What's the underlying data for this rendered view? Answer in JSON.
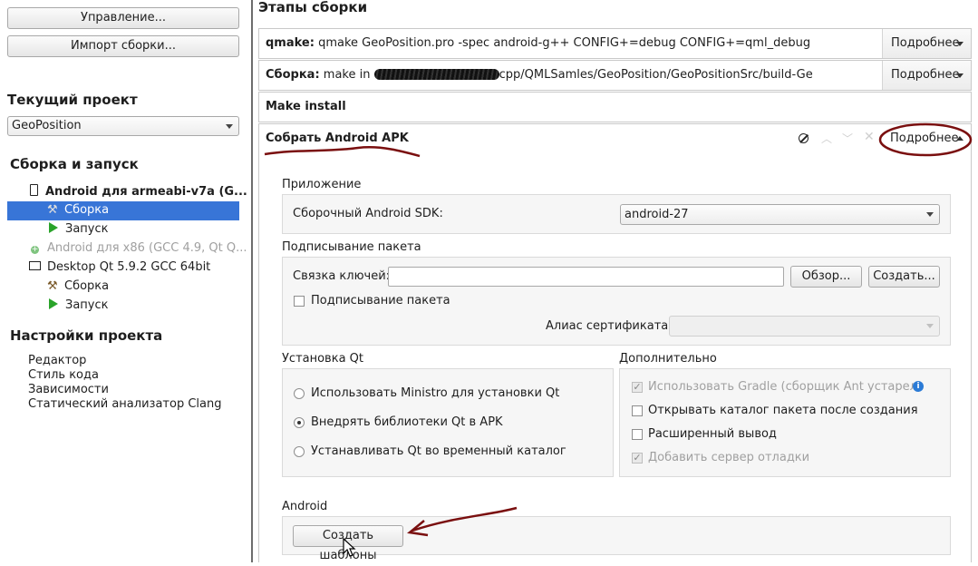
{
  "left": {
    "manage_btn": "Управление...",
    "import_btn": "Импорт сборки...",
    "current_project_title": "Текущий проект",
    "project_select": "GeoPosition",
    "build_run_title": "Сборка и запуск",
    "kits": [
      {
        "label": "Android для armeabi-v7a (G...",
        "build": "Сборка",
        "run": "Запуск"
      },
      {
        "label": "Android для x86 (GCC 4.9, Qt Q..."
      },
      {
        "label": "Desktop Qt 5.9.2 GCC 64bit",
        "build": "Сборка",
        "run": "Запуск"
      }
    ],
    "project_settings_title": "Настройки проекта",
    "settings_links": [
      "Редактор",
      "Стиль кода",
      "Зависимости",
      "Статический анализатор Clang"
    ]
  },
  "main": {
    "title": "Этапы сборки",
    "details_label": "Подробнее",
    "steps": [
      {
        "name": "qmake:",
        "desc": "qmake GeoPosition.pro -spec android-g++ CONFIG+=debug CONFIG+=qml_debug"
      },
      {
        "name": "Сборка:",
        "desc_pre": "make in",
        "desc": "cpp/QMLSamles/GeoPosition/GeoPositionSrc/build-Ge"
      },
      {
        "name": "Make install"
      },
      {
        "name": "Собрать Android APK"
      }
    ],
    "application_group": "Приложение",
    "sdk_label": "Сборочный Android SDK:",
    "sdk_value": "android-27",
    "signing_group": "Подписывание пакета",
    "keystore_label": "Связка ключей:",
    "browse_btn": "Обзор...",
    "create_btn": "Создать...",
    "sign_pkg_check": "Подписывание пакета",
    "cert_alias_label": "Алиас сертификата:",
    "qt_install_group": "Установка Qt",
    "qt_options": [
      "Использовать Ministro для установки Qt",
      "Внедрять библиотеки Qt в APK",
      "Устанавливать Qt во временный каталог"
    ],
    "qt_selected": 1,
    "advanced_group": "Дополнительно",
    "advanced_options": [
      {
        "label": "Использовать Gradle (сборщик Ant устарел)",
        "checked": true,
        "disabled": true
      },
      {
        "label": "Открывать каталог пакета после создания",
        "checked": false,
        "disabled": false
      },
      {
        "label": "Расширенный вывод",
        "checked": false,
        "disabled": false
      },
      {
        "label": "Добавить сервер отладки",
        "checked": true,
        "disabled": true
      }
    ],
    "android_group": "Android",
    "create_templates_btn": "Создать шаблоны"
  },
  "colors": {
    "selection": "#3875d7",
    "annotation": "#7a0f0f",
    "play": "#2aa32a",
    "info": "#2b7bd6"
  }
}
